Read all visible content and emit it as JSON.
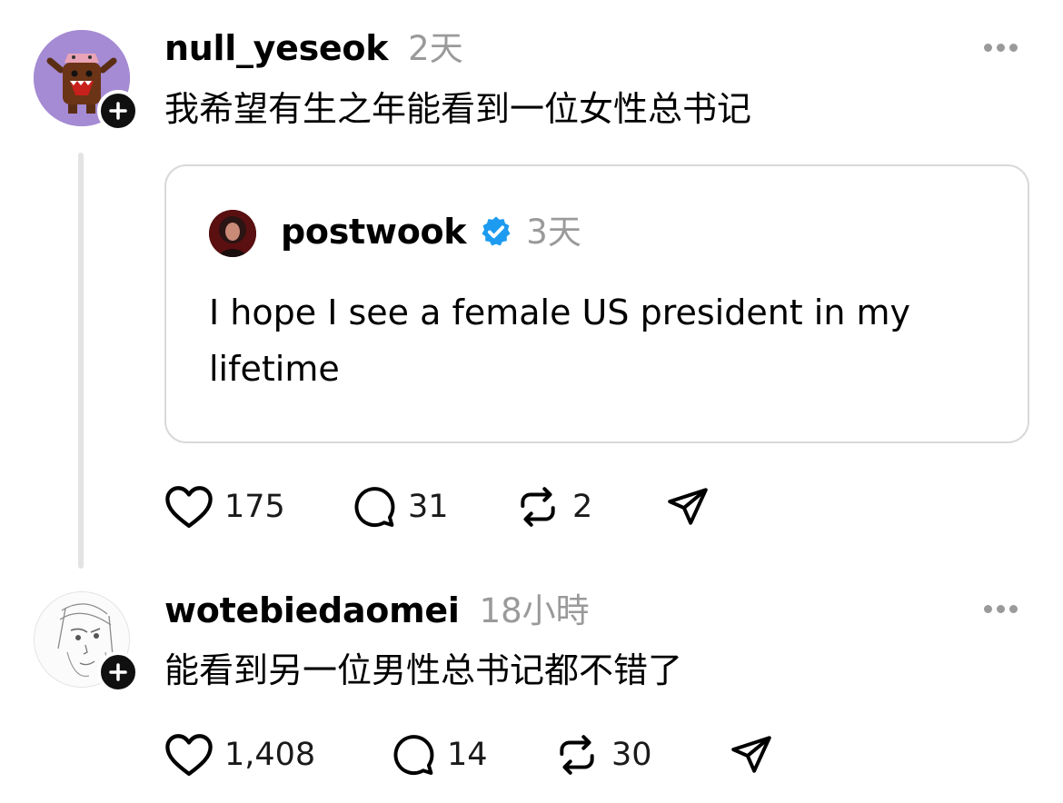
{
  "post1": {
    "username": "null_yeseok",
    "time": "2天",
    "text": "我希望有生之年能看到一位女性总书记",
    "quote": {
      "username": "postwook",
      "time": "3天",
      "text": "I hope I see a female US president in my lifetime"
    },
    "actions": {
      "likes": "175",
      "replies": "31",
      "reposts": "2"
    }
  },
  "post2": {
    "username": "wotebiedaomei",
    "time": "18小時",
    "text": "能看到另一位男性总书记都不错了",
    "actions": {
      "likes": "1,408",
      "replies": "14",
      "reposts": "30"
    }
  },
  "colors": {
    "verified": "#1d9bf0",
    "muted": "#9a9a9a",
    "thread_line": "#e3e3e3"
  }
}
